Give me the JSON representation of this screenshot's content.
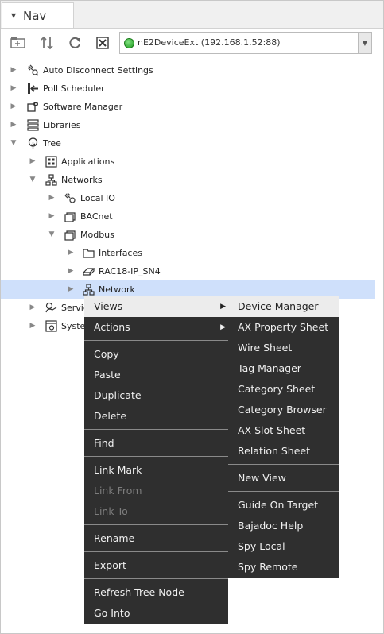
{
  "nav": {
    "title": "Nav",
    "station": "nE2DeviceExt (192.168.1.52:88)"
  },
  "tree": {
    "items": [
      {
        "label": "Auto Disconnect Settings",
        "icon": "plug-icon"
      },
      {
        "label": "Poll Scheduler",
        "icon": "poll-icon"
      },
      {
        "label": "Software Manager",
        "icon": "software-icon"
      },
      {
        "label": "Libraries",
        "icon": "libraries-icon"
      },
      {
        "label": "Tree",
        "icon": "tree-icon"
      },
      {
        "label": "Applications",
        "icon": "applications-icon"
      },
      {
        "label": "Networks",
        "icon": "network-icon"
      },
      {
        "label": "Local IO",
        "icon": "localio-icon"
      },
      {
        "label": "BACnet",
        "icon": "folder-stack-icon"
      },
      {
        "label": "Modbus",
        "icon": "folder-stack-icon"
      },
      {
        "label": "Interfaces",
        "icon": "folder-icon"
      },
      {
        "label": "RAC18-IP_SN4",
        "icon": "device-icon"
      },
      {
        "label": "Network",
        "icon": "network-icon"
      },
      {
        "label": "Servic",
        "icon": "services-icon"
      },
      {
        "label": "Syster",
        "icon": "system-icon"
      }
    ]
  },
  "context_menu": {
    "items": [
      {
        "label": "Views",
        "state": "highlighted"
      },
      {
        "label": "Actions"
      },
      {
        "label": "Copy"
      },
      {
        "label": "Paste"
      },
      {
        "label": "Duplicate"
      },
      {
        "label": "Delete"
      },
      {
        "label": "Find"
      },
      {
        "label": "Link Mark"
      },
      {
        "label": "Link From",
        "state": "disabled"
      },
      {
        "label": "Link To",
        "state": "disabled"
      },
      {
        "label": "Rename"
      },
      {
        "label": "Export"
      },
      {
        "label": "Refresh Tree Node"
      },
      {
        "label": "Go Into"
      }
    ]
  },
  "views_menu": {
    "items": [
      {
        "label": "Device Manager",
        "state": "highlighted"
      },
      {
        "label": "AX Property Sheet"
      },
      {
        "label": "Wire Sheet"
      },
      {
        "label": "Tag Manager"
      },
      {
        "label": "Category Sheet"
      },
      {
        "label": "Category Browser"
      },
      {
        "label": "AX Slot Sheet"
      },
      {
        "label": "Relation Sheet"
      },
      {
        "label": "New View"
      },
      {
        "label": "Guide On Target"
      },
      {
        "label": "Bajadoc Help"
      },
      {
        "label": "Spy Local"
      },
      {
        "label": "Spy Remote"
      }
    ]
  }
}
